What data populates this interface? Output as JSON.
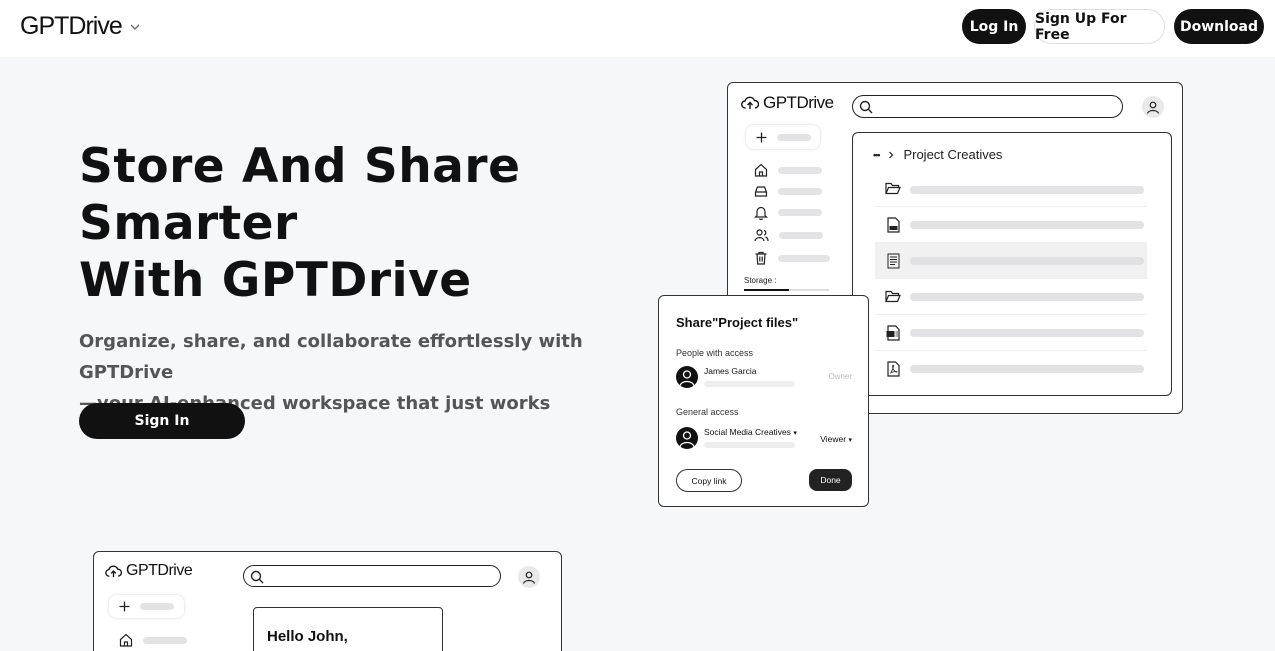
{
  "header": {
    "brand": "GPTDrive",
    "login_label": "Log In",
    "signup_label": "Sign Up For Free",
    "download_label": "Download"
  },
  "hero": {
    "title_lines": [
      "Store And Share",
      "Smarter",
      "With GPTDrive"
    ],
    "subtitle_lines": [
      "Organize, share, and collaborate effortlessly with GPTDrive",
      "—your AI-enhanced workspace that just works"
    ],
    "signin_label": "Sign In"
  },
  "mockup_main": {
    "brand": "GPTDrive",
    "storage_label": "Storage :",
    "breadcrumb_more": "•••",
    "breadcrumb_folder": "Project Creatives",
    "sidebar_icons": [
      "home-icon",
      "drive-icon",
      "bell-icon",
      "users-icon",
      "trash-icon"
    ],
    "file_icons": [
      "folder-icon",
      "document-icon",
      "text-file-icon",
      "folder-icon",
      "spreadsheet-icon",
      "pdf-icon"
    ]
  },
  "share_dialog": {
    "title": "Share\"Project files\"",
    "people_label": "People with access",
    "person_name": "James Garcia",
    "person_role": "Owner",
    "general_label": "General access",
    "group_name": "Social Media Creatives",
    "group_role": "Viewer",
    "copy_link_label": "Copy link",
    "done_label": "Done"
  },
  "mockup_bottom": {
    "brand": "GPTDrive",
    "greeting": "Hello John,"
  }
}
